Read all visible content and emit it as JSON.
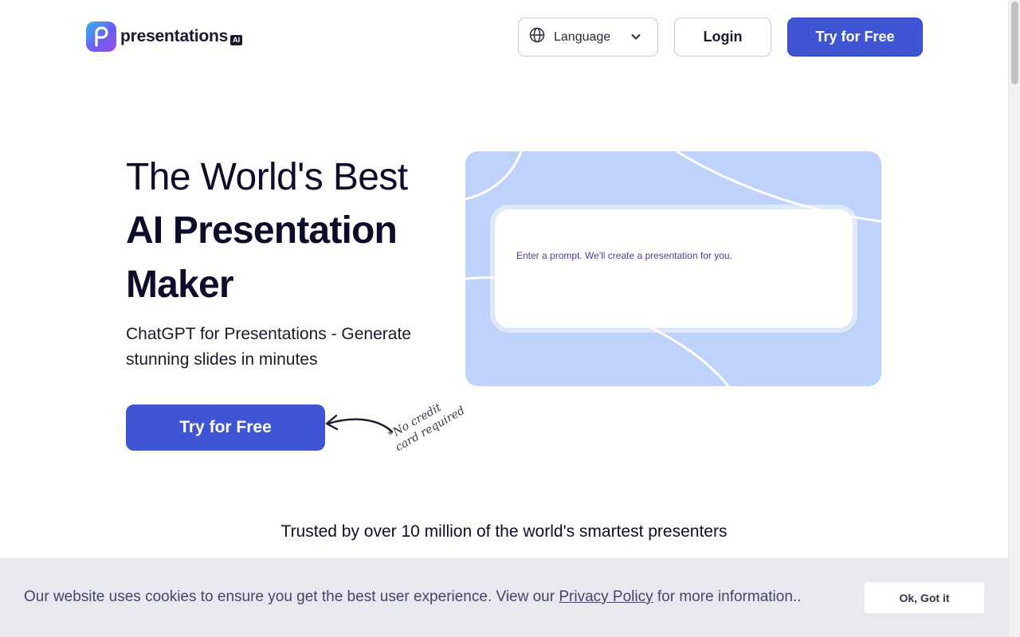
{
  "header": {
    "logo_text": "presentations",
    "logo_badge": "AI",
    "language_label": "Language",
    "login_label": "Login",
    "try_label": "Try for Free"
  },
  "hero": {
    "title_line1": "The World's Best",
    "title_line2": "AI Presentation",
    "title_line3": "Maker",
    "subtitle": "ChatGPT for Presentations - Generate stunning slides in minutes",
    "cta_label": "Try for Free",
    "note_line1": "*No credit",
    "note_line2": "card required"
  },
  "prompt": {
    "placeholder": "Enter a prompt. We'll create a presentation for you."
  },
  "trusted": {
    "text": "Trusted by over 10 million of the world's smartest presenters"
  },
  "cookie": {
    "text_before": "Our website uses cookies to ensure you get the best user experience. View our ",
    "link_label": "Privacy Policy",
    "text_after": " for more information..",
    "ok_label": "Ok, Got it"
  },
  "colors": {
    "primary": "#3f55d4",
    "card_bg": "#bed2fb",
    "cookie_bg": "#e8e9ef"
  }
}
